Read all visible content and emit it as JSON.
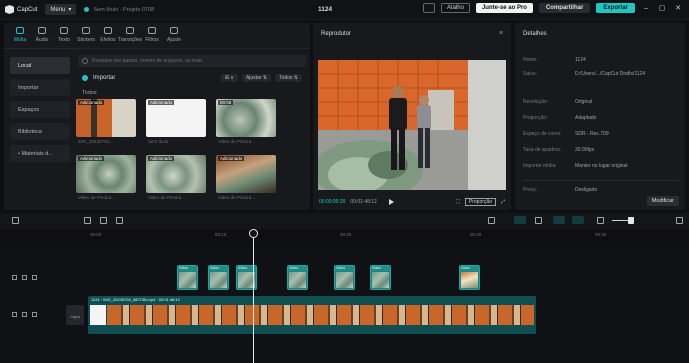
{
  "topbar": {
    "app_name": "CapCut",
    "menu_label": "Menu",
    "project_name": "Sem título · Projeto 0708",
    "center_title": "1124",
    "atalho_label": "Atalho",
    "join_pro_label": "Junte-se ao Pro",
    "share_label": "Compartilhar",
    "export_label": "Exportar"
  },
  "tools": [
    {
      "label": "Mídia",
      "icon": "media-icon",
      "active": true
    },
    {
      "label": "Áudio",
      "icon": "audio-icon"
    },
    {
      "label": "Texto",
      "icon": "text-icon"
    },
    {
      "label": "Stickers",
      "icon": "sticker-icon"
    },
    {
      "label": "Efeitos",
      "icon": "effects-icon"
    },
    {
      "label": "Transições",
      "icon": "transition-icon"
    },
    {
      "label": "Filtros",
      "icon": "filter-icon"
    },
    {
      "label": "Ajuste",
      "icon": "adjust-icon"
    }
  ],
  "sidebar": [
    "Local",
    "Importar",
    "Espaços",
    "Biblioteca",
    "• Materiais d..."
  ],
  "search_placeholder": "Pesquise por pastas, nomes de arquivos, ou mais",
  "import_label": "Importar",
  "filter_chips": [
    "⊞ ∨",
    "Ajustar ⇅",
    "Todos ⇅"
  ],
  "grid_label": "Todos",
  "media_items": [
    {
      "badge": "Adicionado",
      "caption": "IMG_20240704..."
    },
    {
      "badge": "Adicionado",
      "caption": "Sem título"
    },
    {
      "badge": "00:05",
      "caption": "Video de Pintura..."
    },
    {
      "badge": "Adicionado",
      "caption": "Video de Pintura..."
    },
    {
      "badge": "Adicionado",
      "caption": "Video de Pintura..."
    },
    {
      "badge": "Adicionado",
      "caption": "Video de Pintura..."
    }
  ],
  "player": {
    "title": "Reprodutor",
    "time_current": "00:00:09:29",
    "time_total": "00:01:48:12",
    "fullscreen_ratio": "Proporção"
  },
  "details": {
    "title": "Detalhes",
    "rows": [
      {
        "k": "Nome:",
        "v": "1124"
      },
      {
        "k": "Salvo:",
        "v": "D:/Users/.../CapCut Drafts/1124"
      },
      {
        "k": "Resolução:",
        "v": "Original"
      },
      {
        "k": "Proporção:",
        "v": "Adaptado"
      },
      {
        "k": "Espaço de cores:",
        "v": "SDR - Rec.709"
      },
      {
        "k": "Taxa de quadros:",
        "v": "30.00fps"
      },
      {
        "k": "Importar mídia:",
        "v": "Manter no lugar original"
      },
      {
        "k": "Proxy:",
        "v": "Desligado"
      }
    ],
    "modify_label": "Modificar"
  },
  "ruler": [
    "00:00",
    "00:10",
    "00:20",
    "00:30",
    "00:40",
    "00:50"
  ],
  "cover_label": "Capa",
  "main_track_label": "1124 · IMG_20240704_082738.mp4 · 00:01:48:12",
  "overlay_badge": "Vídeo"
}
